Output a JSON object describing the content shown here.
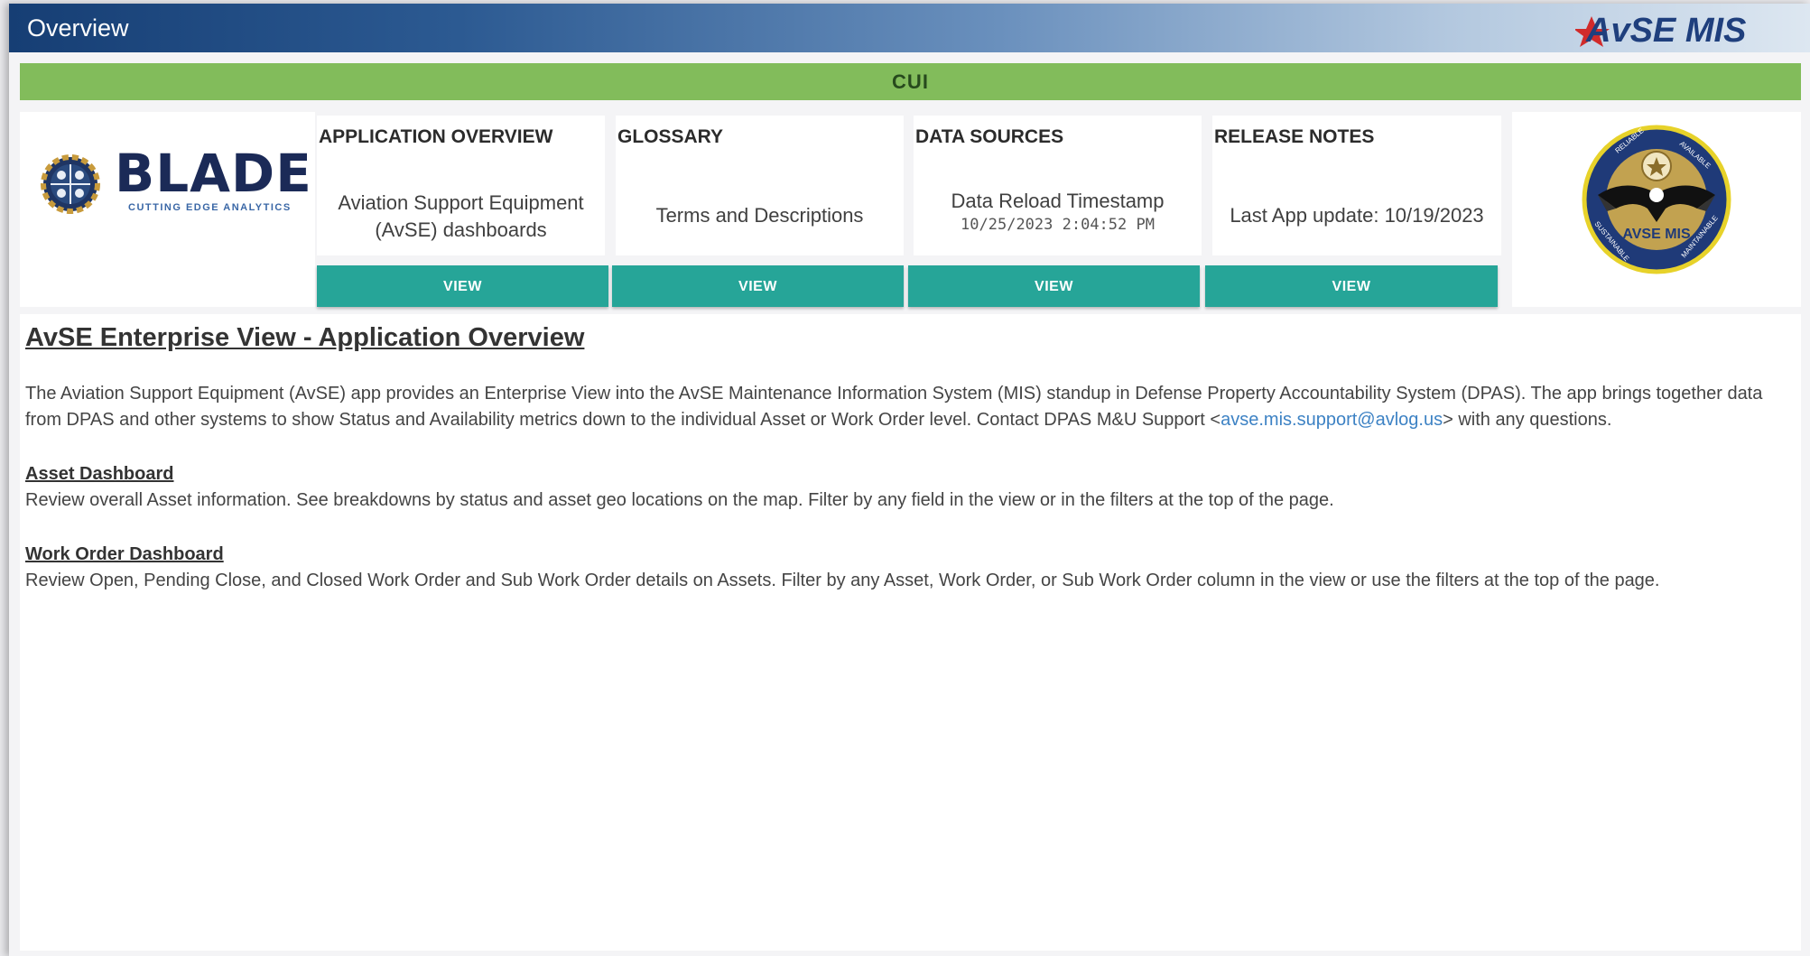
{
  "window": {
    "title": "Overview",
    "brand": "AvSE MIS"
  },
  "banner": {
    "classification": "CUI"
  },
  "logo": {
    "name": "BLADE",
    "tagline": "CUTTING EDGE ANALYTICS"
  },
  "cards": [
    {
      "title": "APPLICATION OVERVIEW",
      "line1": "Aviation Support Equipment",
      "line2": "(AvSE)  dashboards",
      "button": "VIEW"
    },
    {
      "title": "GLOSSARY",
      "line1": "Terms and Descriptions",
      "button": "VIEW"
    },
    {
      "title": "DATA SOURCES",
      "line1": "Data Reload Timestamp",
      "line2": "10/25/2023 2:04:52 PM",
      "button": "VIEW"
    },
    {
      "title": "RELEASE NOTES",
      "line1": "Last App update: 10/19/2023",
      "button": "VIEW"
    }
  ],
  "emblem": {
    "center_text": "AVSE MIS",
    "top_left": "RELIABLE",
    "top_right": "AVAILABLE",
    "bottom_left": "SUSTAINABLE",
    "bottom_right": "MAINTAINABLE"
  },
  "content": {
    "heading": "AvSE Enterprise View - Application Overview",
    "intro_before_link": "The Aviation Support Equipment (AvSE) app provides an Enterprise View into the AvSE Maintenance Information System (MIS) standup in Defense Property Accountability System (DPAS). The app brings together data from DPAS and other systems to show Status and Availability metrics down to the individual Asset or Work Order level. Contact DPAS M&U Support <",
    "intro_link": "avse.mis.support@avlog.us",
    "intro_after_link": "> with any questions.",
    "asset_title": "Asset Dashboard",
    "asset_text": "Review overall Asset information. See breakdowns by status and asset geo locations on the map. Filter by any field in the view or in the filters at the top of the page.",
    "workorder_title": "Work Order Dashboard",
    "workorder_text": "Review Open, Pending Close, and Closed Work Order and Sub Work Order details on Assets. Filter by any Asset, Work Order, or Sub Work Order column in the view or use the filters at the top of the page."
  },
  "colors": {
    "accent": "#26a598",
    "cui_banner": "#82bc5b",
    "title_dark": "#163e74",
    "link": "#3d82c4"
  }
}
